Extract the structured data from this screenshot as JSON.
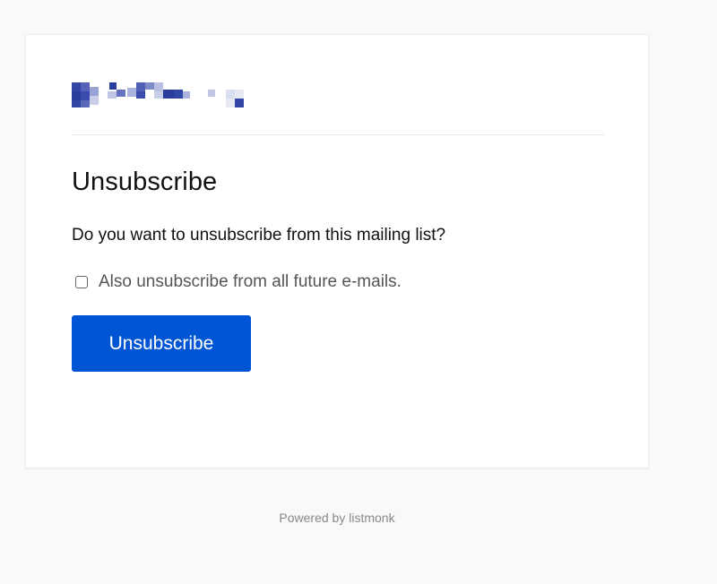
{
  "unsubscribe_page": {
    "logo_icon": "pixelated-logo-icon",
    "title": "Unsubscribe",
    "question": "Do you want to unsubscribe from this mailing list?",
    "checkbox_label": "Also unsubscribe from all future e-mails.",
    "checkbox_checked": false,
    "button_label": "Unsubscribe"
  },
  "footer": {
    "text": "Powered by listmonk"
  },
  "colors": {
    "accent": "#0055d4",
    "logo_primary": "#2c3fa0",
    "page_background": "#f9f9f9",
    "card_background": "#ffffff"
  }
}
